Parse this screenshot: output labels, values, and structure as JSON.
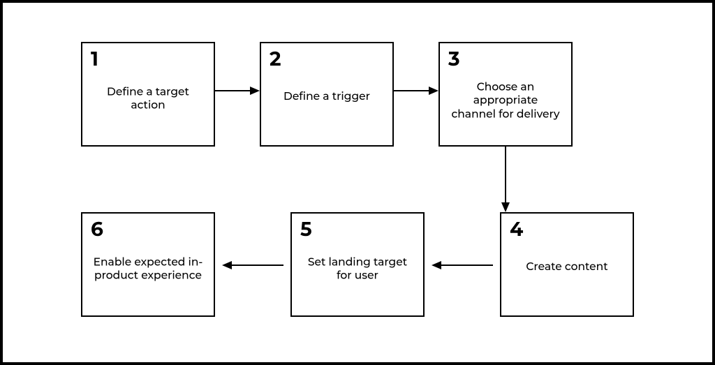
{
  "diagram": {
    "steps": [
      {
        "num": "1",
        "label": "Define a target action"
      },
      {
        "num": "2",
        "label": "Define a trigger"
      },
      {
        "num": "3",
        "label": "Choose an appropriate channel for delivery"
      },
      {
        "num": "4",
        "label": "Create content"
      },
      {
        "num": "5",
        "label": "Set landing target for user"
      },
      {
        "num": "6",
        "label": "Enable expected in-product experience"
      }
    ]
  }
}
